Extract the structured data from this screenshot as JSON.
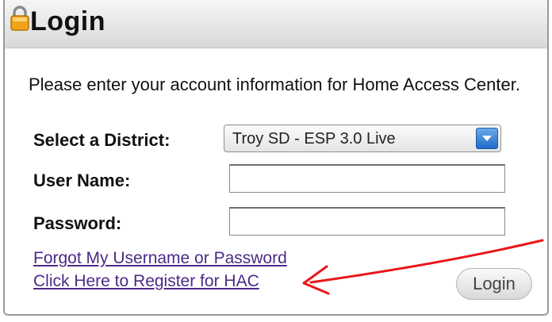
{
  "panel": {
    "title": "Login"
  },
  "intro": {
    "text": "Please enter your account information for Home Access Center."
  },
  "form": {
    "district_label": "Select a District:",
    "district_value": "Troy SD - ESP 3.0 Live",
    "username_label": "User Name:",
    "username_value": "",
    "password_label": "Password:",
    "password_value": ""
  },
  "links": {
    "forgot": "Forgot My Username or Password",
    "register": "Click Here to Register for HAC"
  },
  "actions": {
    "login_label": "Login"
  },
  "icons": {
    "lock": "lock-icon",
    "dropdown": "chevron-down-icon",
    "annotation": "red-arrow"
  },
  "colors": {
    "link": "#4b2a86",
    "dropdown_accent": "#1f6cc9",
    "annotation_arrow": "#e8161b"
  }
}
